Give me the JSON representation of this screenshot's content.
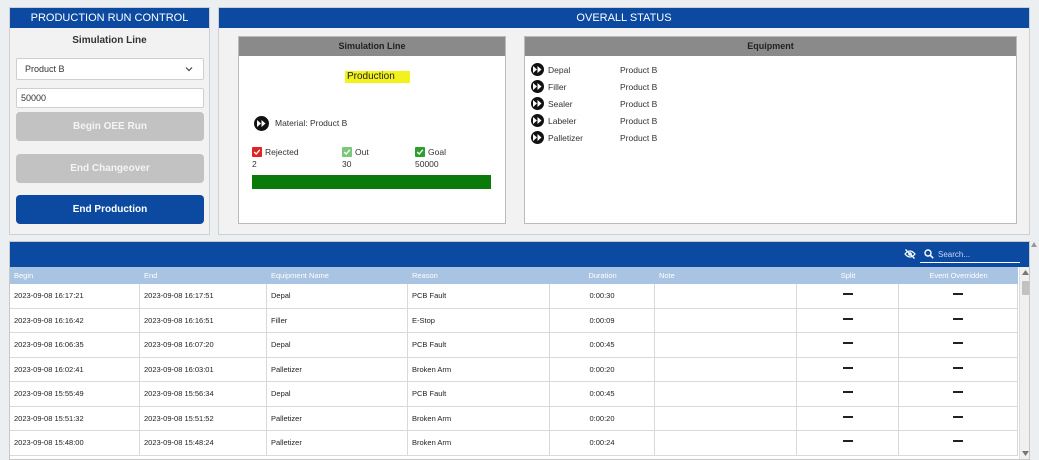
{
  "left_panel": {
    "title": "PRODUCTION RUN CONTROL",
    "sim_line_label": "Simulation Line",
    "selected_product": "Product B",
    "quantity_value": "50000",
    "begin_btn": "Begin OEE Run",
    "changeover_btn": "End Changeover",
    "end_production_btn": "End Production"
  },
  "status_panel": {
    "title": "OVERALL STATUS",
    "sim_box": {
      "title": "Simulation Line",
      "state": "Production",
      "material": "Material: Product B",
      "counts": {
        "rejected_label": "Rejected",
        "rejected_value": "2",
        "out_label": "Out",
        "out_value": "30",
        "goal_label": "Goal",
        "goal_value": "50000"
      },
      "progress_fraction": 1.0
    },
    "equipment_box": {
      "title": "Equipment",
      "items": [
        {
          "name": "Depal",
          "product": "Product B"
        },
        {
          "name": "Filler",
          "product": "Product B"
        },
        {
          "name": "Sealer",
          "product": "Product B"
        },
        {
          "name": "Labeler",
          "product": "Product B"
        },
        {
          "name": "Palletizer",
          "product": "Product B"
        }
      ]
    }
  },
  "events": {
    "search_placeholder": "Search...",
    "columns": [
      "Begin",
      "End",
      "Equipment Name",
      "Reason",
      "Duration",
      "Note",
      "Split",
      "Event Overridden"
    ],
    "rows": [
      {
        "begin": "2023-09-08 16:17:21",
        "end": "2023-09-08 16:17:51",
        "equipment": "Depal",
        "reason": "PCB Fault",
        "duration": "0:00:30",
        "note": ""
      },
      {
        "begin": "2023-09-08 16:16:42",
        "end": "2023-09-08 16:16:51",
        "equipment": "Filler",
        "reason": "E-Stop",
        "duration": "0:00:09",
        "note": ""
      },
      {
        "begin": "2023-09-08 16:06:35",
        "end": "2023-09-08 16:07:20",
        "equipment": "Depal",
        "reason": "PCB Fault",
        "duration": "0:00:45",
        "note": ""
      },
      {
        "begin": "2023-09-08 16:02:41",
        "end": "2023-09-08 16:03:01",
        "equipment": "Palletizer",
        "reason": "Broken Arm",
        "duration": "0:00:20",
        "note": ""
      },
      {
        "begin": "2023-09-08 15:55:49",
        "end": "2023-09-08 15:56:34",
        "equipment": "Depal",
        "reason": "PCB Fault",
        "duration": "0:00:45",
        "note": ""
      },
      {
        "begin": "2023-09-08 15:51:32",
        "end": "2023-09-08 15:51:52",
        "equipment": "Palletizer",
        "reason": "Broken Arm",
        "duration": "0:00:20",
        "note": ""
      },
      {
        "begin": "2023-09-08 15:48:00",
        "end": "2023-09-08 15:48:24",
        "equipment": "Palletizer",
        "reason": "Broken Arm",
        "duration": "0:00:24",
        "note": ""
      }
    ]
  },
  "colors": {
    "header_blue": "#0b4aa0",
    "progress_green": "#0a7a0a",
    "state_highlight": "#f3f21c",
    "table_header": "#a9c4e2",
    "rejected_red": "#e02424",
    "ok_green": "#2e9e2e"
  }
}
